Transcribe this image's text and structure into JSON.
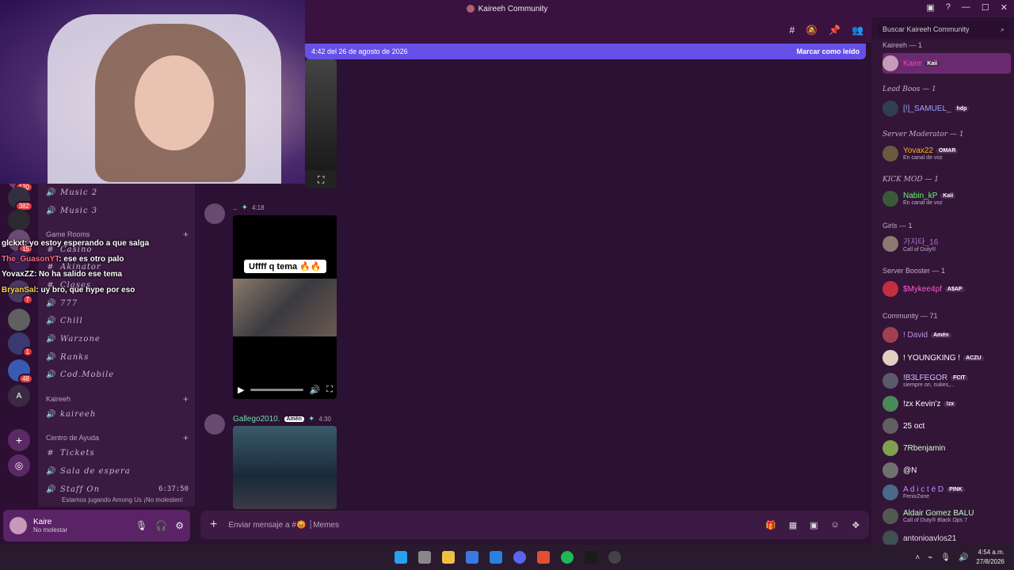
{
  "window": {
    "title": "Kaireeh Community"
  },
  "server_rail": {
    "servers": [
      {
        "label": "",
        "badge": "120"
      },
      {
        "label": "",
        "badge": "382"
      },
      {
        "label": "",
        "badge": ""
      },
      {
        "label": "",
        "badge": "15"
      },
      {
        "label": "",
        "badge": ""
      },
      {
        "label": "",
        "badge": "7"
      },
      {
        "label": "",
        "badge": ""
      },
      {
        "label": "",
        "badge": "1"
      },
      {
        "label": "",
        "badge": "48"
      },
      {
        "label": "A",
        "badge": ""
      }
    ]
  },
  "channels": {
    "items_top": [
      {
        "name": "Music 2",
        "icon": "🔊"
      },
      {
        "name": "Music 3",
        "icon": "🔊"
      }
    ],
    "cat_game_rooms": "Game Rooms",
    "game_rooms": [
      {
        "name": "Casino",
        "icon": "#"
      },
      {
        "name": "Akinator",
        "icon": "#"
      },
      {
        "name": "Clases",
        "icon": "#"
      },
      {
        "name": "777",
        "icon": "🔊"
      },
      {
        "name": "Chill",
        "icon": "🔊"
      },
      {
        "name": "Warzone",
        "icon": "🔊"
      },
      {
        "name": "Ranks",
        "icon": "🔊"
      },
      {
        "name": "Cod.Mobile",
        "icon": "🔊"
      }
    ],
    "cat_kaireeh": "Kaireeh",
    "kaireeh_items": [
      {
        "name": "kaireeh",
        "icon": "🔊"
      }
    ],
    "cat_help": "Centro de Ayuda",
    "help_items": [
      {
        "name": "Tickets",
        "icon": "#"
      },
      {
        "name": "Sala de espera",
        "icon": "🔊"
      },
      {
        "name": "Staff On",
        "icon": "🔊",
        "timer": "6:37:50"
      }
    ],
    "staff_status": "Estamos jugando Among Us ¡No molesten!"
  },
  "user_panel": {
    "name": "Kaire",
    "status": "No molestar"
  },
  "stream_chat": [
    {
      "user": "glckxt",
      "color": "#ffffff",
      "text": ": yo estoy esperando a que salga"
    },
    {
      "user": "The_GuasonYT",
      "color": "#ff6b8a",
      "text": ": ese es otro palo"
    },
    {
      "user": "YovaxZZ",
      "color": "#ffffff",
      "text": ": No ha salido ese tema"
    },
    {
      "user": "BryanSal",
      "color": "#ffd24a",
      "text": ": uy bro, que hype por eso"
    }
  ],
  "chat": {
    "new_messages_text": "4:42 del 26 de agosto de 2026",
    "mark_read": "Marcar como leído",
    "msg1_time": "4:18",
    "video_caption": "Uffff q tema 🔥🔥",
    "msg2_user": "Gallego2010.",
    "msg2_tag": "Amén",
    "msg2_time": "4:30",
    "composer_placeholder": "Enviar mensaje a #😡 ┆Memes"
  },
  "members": {
    "search_placeholder": "Buscar Kaireeh Community",
    "groups": [
      {
        "label": "Kaireeh — 1",
        "italic": false
      },
      {
        "label": "Lead Boos — 1",
        "italic": true
      },
      {
        "label": "Server Moderator — 1",
        "italic": true
      },
      {
        "label": "KICK MOD — 1",
        "italic": true
      },
      {
        "label": "Girls — 1",
        "italic": false
      },
      {
        "label": "Server Booster — 1",
        "italic": false
      },
      {
        "label": "Community — 71",
        "italic": false
      }
    ],
    "list": [
      {
        "name": "Kaire",
        "color": "#ff3fb8",
        "tag": "Kaii",
        "sub": ""
      },
      {
        "name": "[!]_SAMUEL_",
        "color": "#9ea0ff",
        "tag": "hdp",
        "sub": ""
      },
      {
        "name": "Yovax22",
        "color": "#ffb020",
        "tag": "OMAR",
        "sub": "En canal de voz"
      },
      {
        "name": "Nabin_kP",
        "color": "#5aff6a",
        "tag": "Kaii",
        "sub": "En canal de voz"
      },
      {
        "name": "가지타_16",
        "color": "#b070d0",
        "tag": "",
        "sub": "Call of Duty®"
      },
      {
        "name": "$Mykee4pf",
        "color": "#ff5ad0",
        "tag": "A$AP",
        "sub": ""
      },
      {
        "name": "! David",
        "color": "#c090e0",
        "tag": "Amén",
        "sub": ""
      },
      {
        "name": "! YOUNGKING !",
        "color": "#ffffff",
        "tag": "ACZU",
        "sub": ""
      },
      {
        "name": "!B3LFEGOR",
        "color": "#d0c0ff",
        "tag": "FCIT",
        "sub": "siempre on, nukes,..."
      },
      {
        "name": "!zx Kevin'z",
        "color": "#ffffff",
        "tag": "!zx",
        "sub": ""
      },
      {
        "name": "25 oct",
        "color": "#ffffff",
        "tag": "",
        "sub": ""
      },
      {
        "name": "7Rbenjamin",
        "color": "#d0ffd0",
        "tag": "",
        "sub": ""
      },
      {
        "name": "@N",
        "color": "#ffffff",
        "tag": "",
        "sub": ""
      },
      {
        "name": "A d i c t ë D",
        "color": "#c090ff",
        "tag": "PINK",
        "sub": "FenixZone"
      },
      {
        "name": "Aldair Gomez BALU",
        "color": "#c0ffc0",
        "tag": "",
        "sub": "Call of Duty® Black Ops 7"
      },
      {
        "name": "antonioavlos21",
        "color": "#e0e0e0",
        "tag": "",
        "sub": ""
      }
    ]
  },
  "taskbar": {
    "time": "4:54 a.m.",
    "date": "27/8/2026"
  }
}
